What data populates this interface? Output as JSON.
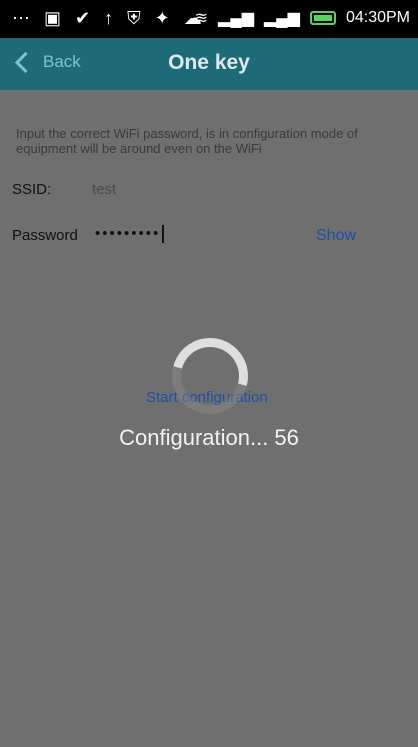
{
  "status_bar": {
    "icons_left": [
      "more-icon",
      "image-icon",
      "check-circle-icon",
      "upload-arrow-icon",
      "shield-icon",
      "cleaner-icon",
      "weather-icon"
    ],
    "time": "04:30PM"
  },
  "app_bar": {
    "back_label": "Back",
    "title": "One key"
  },
  "form": {
    "instruction": "Input the correct WiFi password, is in configuration mode of equipment will be around even on the WiFi",
    "ssid_label": "SSID:",
    "ssid_value": "test",
    "password_label": "Password",
    "password_value": "•••••••••",
    "show_label": "Show",
    "start_label": "Start configuration"
  },
  "dialog": {
    "progress_text": "Configuration... 56",
    "progress_value": 56
  },
  "colors": {
    "app_bar": "#1e6b78",
    "accent_text": "#1f4ea8",
    "battery": "#59d35f"
  }
}
